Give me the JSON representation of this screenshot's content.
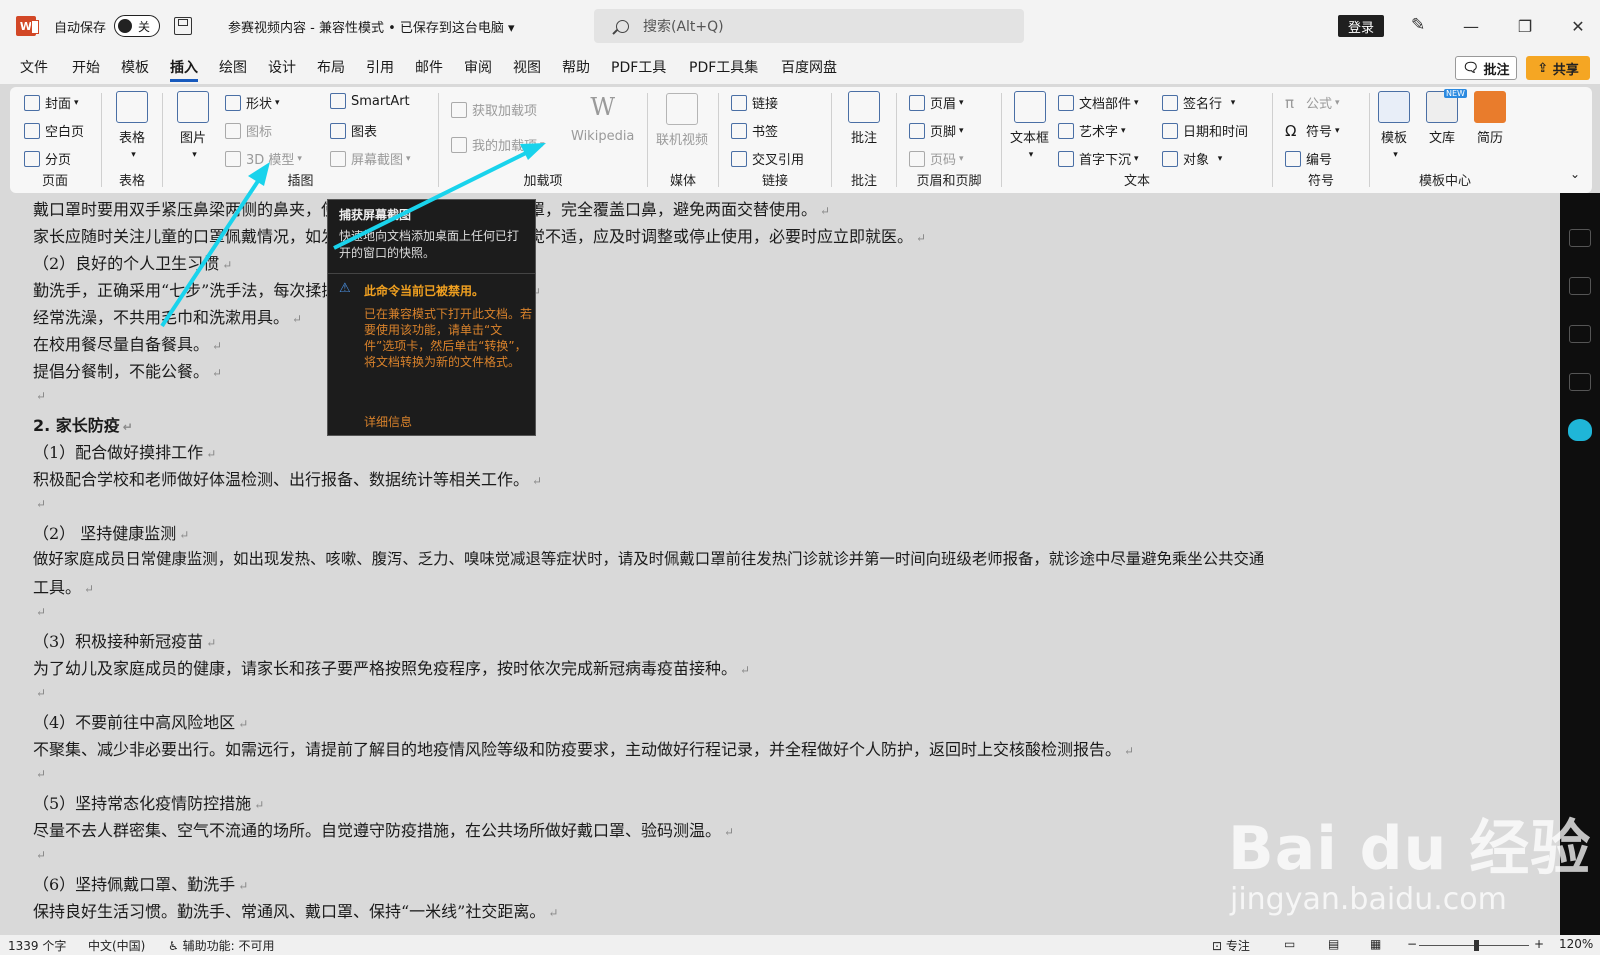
{
  "titlebar": {
    "app_logo": "W",
    "autosave_label": "自动保存",
    "autosave_state": "关",
    "doc_title": "参赛视频内容 - 兼容性模式 • 已保存到这台电脑 ▾",
    "search_placeholder": "搜索(Alt+Q)",
    "login_label": "登录",
    "minimize": "—",
    "restore": "❐",
    "close": "✕"
  },
  "menu": {
    "tabs": [
      "文件",
      "开始",
      "模板",
      "插入",
      "绘图",
      "设计",
      "布局",
      "引用",
      "邮件",
      "审阅",
      "视图",
      "帮助",
      "PDF工具",
      "PDF工具集",
      "百度网盘"
    ],
    "active": "插入",
    "comments_label": "批注",
    "share_label": "共享"
  },
  "ribbon": {
    "pages": {
      "label": "页面",
      "items": [
        "封面",
        "空白页",
        "分页"
      ]
    },
    "table": {
      "label": "表格",
      "button": "表格"
    },
    "illustrations": {
      "label": "插图",
      "picture": "图片",
      "shapes": "形状",
      "icons": "图标",
      "model3d": "3D 模型",
      "smartart": "SmartArt",
      "chart": "图表",
      "screenshot": "屏幕截图"
    },
    "addins": {
      "label": "加载项",
      "get": "获取加载项",
      "my": "我的加载项",
      "wikipedia": "Wikipedia"
    },
    "media": {
      "label": "媒体",
      "online_video": "联机视频"
    },
    "links": {
      "label": "链接",
      "link": "链接",
      "bookmark": "书签",
      "crossref": "交叉引用"
    },
    "comments": {
      "label": "批注",
      "comment": "批注"
    },
    "header_footer": {
      "label": "页眉和页脚",
      "header": "页眉",
      "footer": "页脚",
      "page_number": "页码"
    },
    "text": {
      "label": "文本",
      "textbox": "文本框",
      "quickparts": "文档部件",
      "wordart": "艺术字",
      "dropcap": "首字下沉",
      "signature": "签名行",
      "datetime": "日期和时间",
      "object": "对象"
    },
    "symbols": {
      "label": "符号",
      "equation": "公式",
      "symbol": "符号",
      "number": "编号"
    },
    "template_center": {
      "label": "模板中心",
      "templates": "模板",
      "library": "文库",
      "resume": "简历",
      "new_badge": "NEW"
    }
  },
  "document": {
    "lines": [
      "戴口罩时要用双手紧压鼻梁两侧的鼻夹，使口罩紧贴鼻梁，向下拉伸口罩，完全覆盖口鼻，避免两面交替使用。",
      "家长应随时关注儿童的口罩佩戴情况，如发现儿童在佩戴口罩过程中感觉不适，应及时调整或停止使用，必要时应立即就医。",
      "（2）良好的个人卫生习惯",
      "勤洗手，正确采用“七步”洗手法，每次揉搓后的水吸收不少于 20 秒。",
      "经常洗澡，不共用毛巾和洗漱用具。",
      "在校用餐尽量自备餐具。",
      "提倡分餐制，不能公餐。",
      "",
      "2.  家长防疫",
      "（1）配合做好摸排工作",
      "积极配合学校和老师做好体温检测、出行报备、数据统计等相关工作。",
      "",
      "（2） 坚持健康监测",
      "做好家庭成员日常健康监测，如出现发热、咳嗽、腹泻、乏力、嗅味觉减退等症状时，请及时佩戴口罩前往发热门诊就诊并第一时间向班级老师报备，就诊途中尽量避免乘坐公共交通",
      "工具。",
      "",
      "（3）积极接种新冠疫苗",
      "为了幼儿及家庭成员的健康，请家长和孩子要严格按照免疫程序，按时依次完成新冠病毒疫苗接种。",
      "",
      "（4）不要前往中高风险地区",
      "不聚集、减少非必要出行。如需远行，请提前了解目的地疫情风险等级和防疫要求，主动做好行程记录，并全程做好个人防护，返回时上交核酸检测报告。",
      "",
      "（5）坚持常态化疫情防控措施",
      "尽量不去人群密集、空气不流通的场所。自觉遵守防疫措施，在公共场所做好戴口罩、验码测温。",
      "",
      "（6）坚持佩戴口罩、勤洗手",
      "保持良好生活习惯。勤洗手、常通风、戴口罩、保持“一米线”社交距离。"
    ],
    "paragraph_mark": "↵"
  },
  "tooltip": {
    "title": "捕获屏幕截图",
    "description": "快速地向文档添加桌面上任何已打开的窗口的快照。",
    "warning_title": "此命令当前已被禁用。",
    "warning_body": "已在兼容模式下打开此文档。若要使用该功能，请单击“文件”选项卡，然后单击“转换”，将文档转换为新的文件格式。",
    "more_info": "详细信息"
  },
  "statusbar": {
    "word_count": "1339 个字",
    "language": "中文(中国)",
    "accessibility": "辅助功能: 不可用",
    "focus": "专注",
    "zoom_minus": "−",
    "zoom_plus": "+",
    "zoom_level": "120%"
  },
  "watermark": {
    "brand": "Bai du 经验",
    "url": "jingyan.baidu.com"
  },
  "colors": {
    "accent": "#185abd",
    "arrow": "#19d3ec",
    "share": "#f5a623",
    "warning": "#d9822b"
  }
}
